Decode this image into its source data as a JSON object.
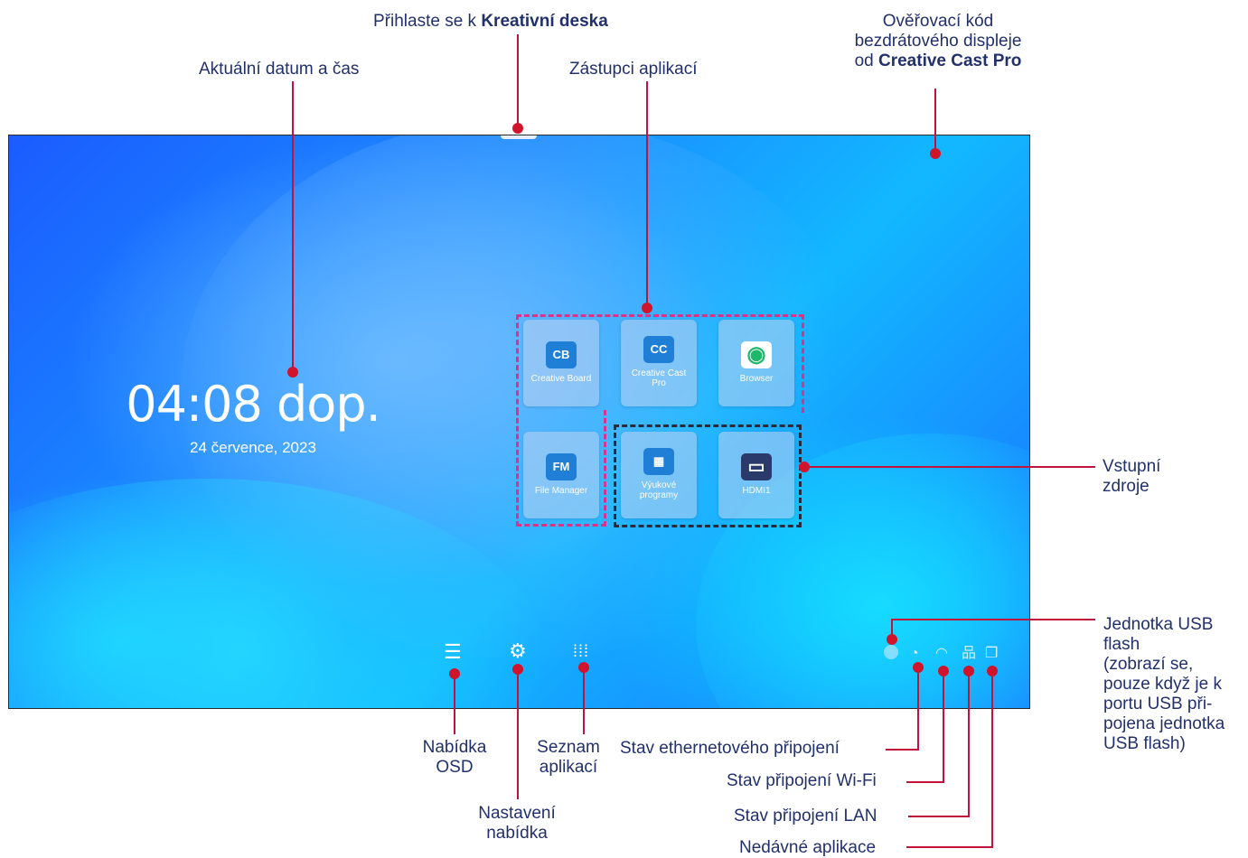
{
  "callouts": {
    "login_prefix": "Přihlaste se k",
    "login_bold": "Kreativní deska",
    "datetime": "Aktuální datum a čas",
    "shortcuts": "Zástupci aplikací",
    "verify_line1": "Ověřovací kód",
    "verify_line2": "bezdrátového displeje",
    "verify_prefix": "od",
    "verify_bold": "Creative Cast Pro",
    "inputs_line1": "Vstupní",
    "inputs_line2": "zdroje",
    "usb_line1": "Jednotka USB",
    "usb_line2": "flash",
    "usb_line3": "(zobrazí se,",
    "usb_line4": "pouze když je k",
    "usb_line5": "portu USB při-",
    "usb_line6": "pojena jednotka",
    "usb_line7": "USB flash)",
    "osd_line1": "Nabídka",
    "osd_line2": "OSD",
    "settings_line1": "Nastavení",
    "settings_line2": "nabídka",
    "applist_line1": "Seznam",
    "applist_line2": "aplikací",
    "ethernet": "Stav ethernetového připojení",
    "wifi": "Stav připojení Wi-Fi",
    "lan": "Stav připojení LAN",
    "recent": "Nedávné aplikace"
  },
  "screen": {
    "time": "04:08 dop.",
    "date": "24 července, 2023"
  },
  "apps": [
    {
      "label": "Creative Board",
      "icon": "CB",
      "icon_name": "creative-board-icon"
    },
    {
      "label": "Creative Cast Pro",
      "icon": "CC",
      "icon_name": "creative-cast-icon"
    },
    {
      "label": "Browser",
      "icon": "◉",
      "icon_name": "browser-icon"
    },
    {
      "label": "File Manager",
      "icon": "FM",
      "icon_name": "file-manager-icon"
    },
    {
      "label": "Výukové programy",
      "icon": "▦",
      "icon_name": "tutorial-icon"
    },
    {
      "label": "HDMI1",
      "icon": "▭",
      "icon_name": "hdmi-icon"
    }
  ],
  "colors": {
    "callout_line": "#c0143c",
    "marker": "#d0142c",
    "pink_dash": "#e0308a",
    "black_dash": "#2a2a3a"
  }
}
